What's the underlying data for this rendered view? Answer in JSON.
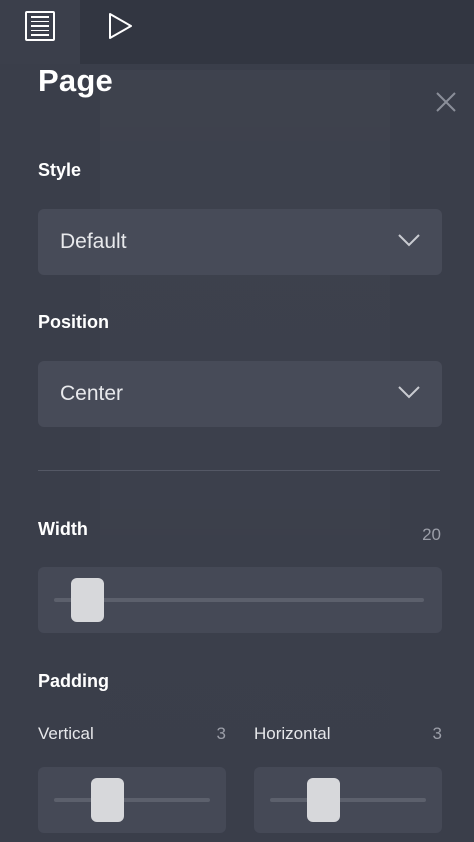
{
  "panel": {
    "title": "Page",
    "style": {
      "label": "Style",
      "value": "Default"
    },
    "position": {
      "label": "Position",
      "value": "Center"
    },
    "width": {
      "label": "Width",
      "value": "20",
      "fraction": 0.05
    },
    "padding": {
      "label": "Padding",
      "vertical": {
        "label": "Vertical",
        "value": "3",
        "fraction": 0.3
      },
      "horizontal": {
        "label": "Horizontal",
        "value": "3",
        "fraction": 0.3
      }
    }
  },
  "icons": {
    "menu": "menu-list-icon",
    "play": "play-icon",
    "close": "close-icon",
    "chevron": "chevron-down-icon"
  },
  "colors": {
    "panel_bg": "#3a3e4a",
    "control_bg": "#474b58",
    "thumb": "#d7d8db",
    "muted_text": "#9b9ea8"
  }
}
